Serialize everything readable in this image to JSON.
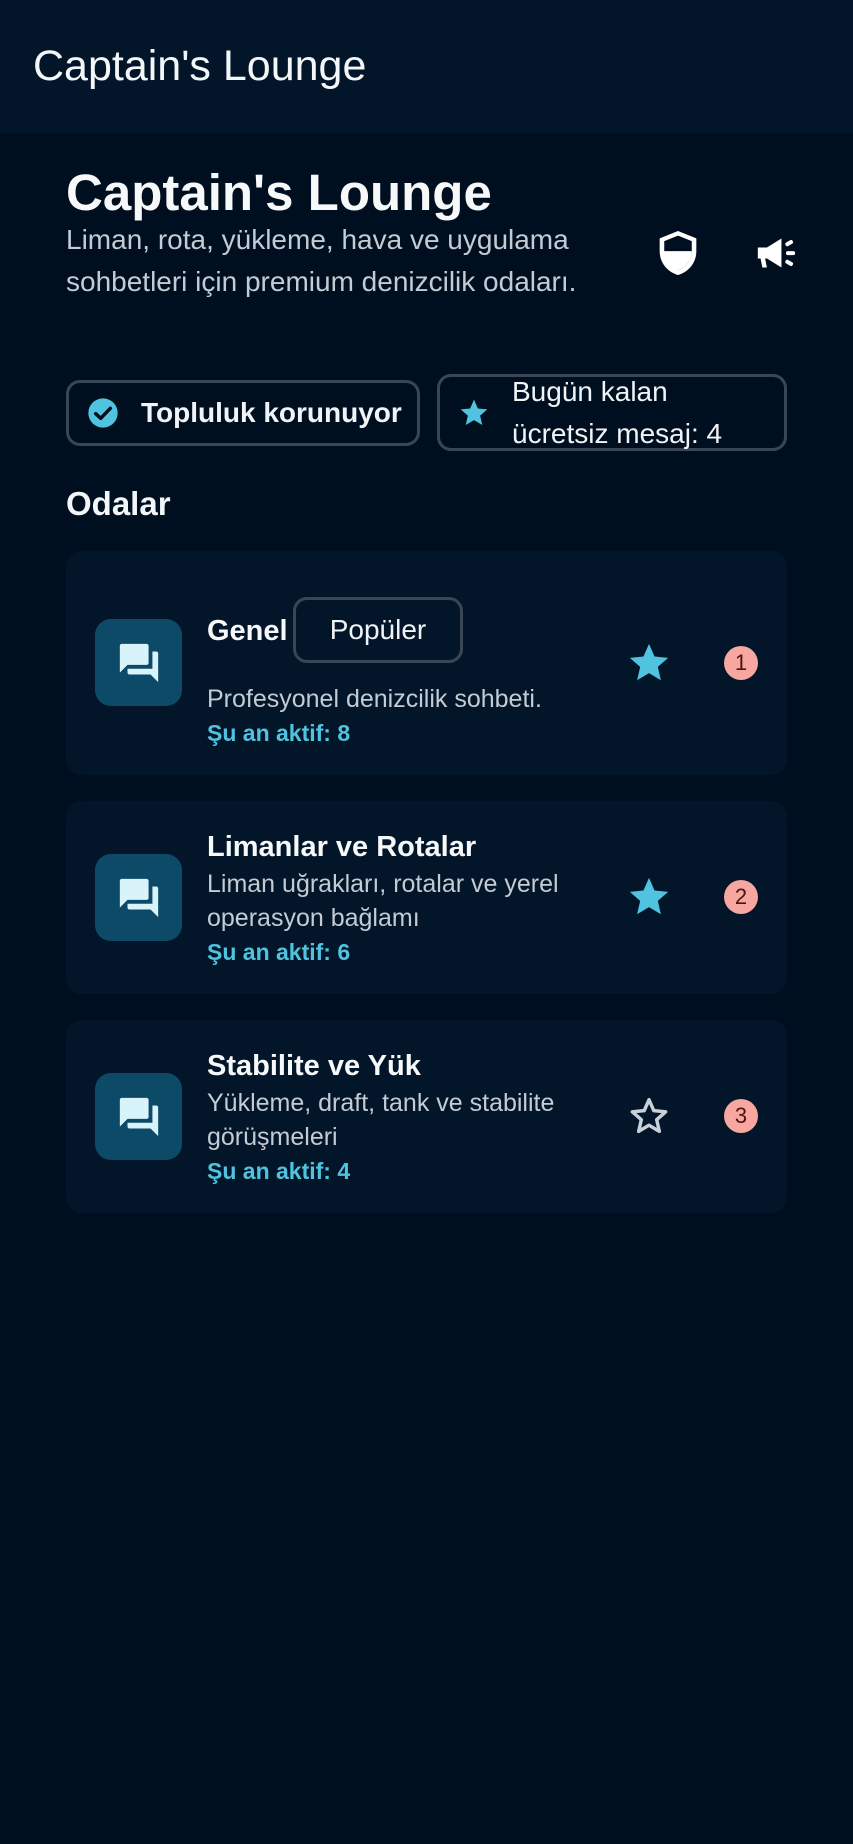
{
  "appbar": {
    "title": "Captain's Lounge"
  },
  "header": {
    "title": "Captain's Lounge",
    "subtitle": "Liman, rota, yükleme, hava ve uygulama sohbetleri için premium denizcilik odaları.",
    "actions": [
      {
        "icon": "shield-icon"
      },
      {
        "icon": "megaphone-icon"
      }
    ]
  },
  "chips": {
    "protected": {
      "label": "Topluluk korunuyor",
      "icon": "check-circle-icon"
    },
    "messages": {
      "label": "Bugün kalan ücretsiz mesaj: 4",
      "icon": "star-icon"
    }
  },
  "rooms_section": {
    "title": "Odalar"
  },
  "rooms": [
    {
      "name": "Genel",
      "tag": "Popüler",
      "description": "Profesyonel denizcilik sohbeti.",
      "active": "Şu an aktif: 8",
      "favorite": true,
      "badge": "1"
    },
    {
      "name": "Limanlar ve Rotalar",
      "description": "Liman uğrakları, rotalar ve yerel operasyon bağlamı",
      "active": "Şu an aktif: 6",
      "favorite": true,
      "badge": "2"
    },
    {
      "name": "Stabilite ve Yük",
      "description": "Yükleme, draft, tank ve stabilite görüşmeleri",
      "active": "Şu an aktif: 4",
      "favorite": false,
      "badge": "3"
    }
  ],
  "colors": {
    "background": "#000f1f",
    "appbar": "#021529",
    "card": "#031629",
    "accent": "#4fc3e0",
    "badge": "#f7a6a0",
    "room_icon_bg": "#0c4a67"
  }
}
